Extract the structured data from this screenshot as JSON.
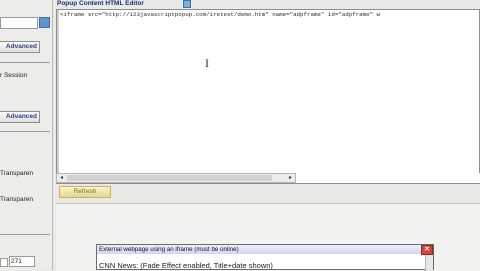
{
  "left_panel": {
    "button_advanced_1": "Advanced",
    "label_session": "r Session",
    "button_advanced_2": "Advanced",
    "label_transparent_1": "Transparen",
    "label_transparent_2": "Transparen",
    "field_value": "271"
  },
  "editor": {
    "title": "Popup Content HTML Editor",
    "content": "<iframe src=\"http://123javascriptpopup.com/iretest/demo.htm\" name=\"adpframe\" id=\"adpframe\" w"
  },
  "toolbar": {
    "refresh_label": "Refresh"
  },
  "popup": {
    "title": "External webpage using an iframe (must be online)",
    "close_glyph": "✕",
    "body": "CNN News: (Fade Effect enabled, Title+date shown)"
  }
}
